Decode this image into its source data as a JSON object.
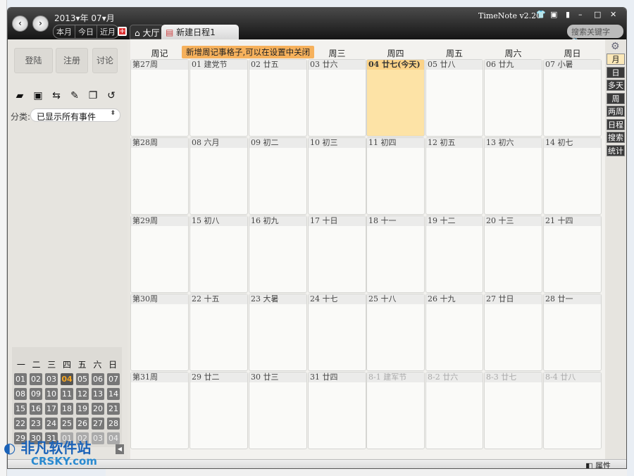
{
  "app": {
    "title": "TimeNote v2.20",
    "year": "2013",
    "year_suffix": "年",
    "month": "07",
    "month_suffix": "月",
    "quick": [
      "本月",
      "今日",
      "近月"
    ],
    "tabs": [
      "大厅",
      "新建日程1"
    ],
    "search_placeholder": "搜索关键字"
  },
  "left": {
    "buttons": [
      "登陆",
      "注册",
      "讨论"
    ],
    "category_label": "分类:",
    "category_value": "已显示所有事件",
    "tool_icons": [
      "folder-open-icon",
      "save-icon",
      "share-icon",
      "edit-icon",
      "copy-icon",
      "undo-icon"
    ]
  },
  "mini": {
    "weekdays": [
      "一",
      "二",
      "三",
      "四",
      "五",
      "六",
      "日"
    ],
    "days": [
      {
        "t": "01"
      },
      {
        "t": "02"
      },
      {
        "t": "03"
      },
      {
        "t": "04",
        "today": true
      },
      {
        "t": "05"
      },
      {
        "t": "06"
      },
      {
        "t": "07"
      },
      {
        "t": "08"
      },
      {
        "t": "09"
      },
      {
        "t": "10"
      },
      {
        "t": "11"
      },
      {
        "t": "12"
      },
      {
        "t": "13"
      },
      {
        "t": "14"
      },
      {
        "t": "15"
      },
      {
        "t": "16"
      },
      {
        "t": "17"
      },
      {
        "t": "18"
      },
      {
        "t": "19"
      },
      {
        "t": "20"
      },
      {
        "t": "21"
      },
      {
        "t": "22"
      },
      {
        "t": "23"
      },
      {
        "t": "24"
      },
      {
        "t": "25"
      },
      {
        "t": "26"
      },
      {
        "t": "27"
      },
      {
        "t": "28"
      },
      {
        "t": "29"
      },
      {
        "t": "30"
      },
      {
        "t": "31"
      },
      {
        "t": "01",
        "other": true
      },
      {
        "t": "02",
        "other": true
      },
      {
        "t": "03",
        "other": true
      },
      {
        "t": "04",
        "other": true
      }
    ]
  },
  "calendar": {
    "headers": [
      "周记",
      "周一",
      "周二",
      "周三",
      "周四",
      "周五",
      "周六",
      "周日"
    ],
    "tip": "新增周记事格子,可以在设置中关闭",
    "weeks": [
      {
        "label": "第27周",
        "days": [
          {
            "t": "01 建党节"
          },
          {
            "t": "02 廿五"
          },
          {
            "t": "03 廿六"
          },
          {
            "t": "04 廿七(今天)",
            "today": true
          },
          {
            "t": "05 廿八"
          },
          {
            "t": "06 廿九"
          },
          {
            "t": "07 小暑"
          }
        ]
      },
      {
        "label": "第28周",
        "days": [
          {
            "t": "08 六月"
          },
          {
            "t": "09 初二"
          },
          {
            "t": "10 初三"
          },
          {
            "t": "11 初四"
          },
          {
            "t": "12 初五"
          },
          {
            "t": "13 初六"
          },
          {
            "t": "14 初七"
          }
        ]
      },
      {
        "label": "第29周",
        "days": [
          {
            "t": "15 初八"
          },
          {
            "t": "16 初九"
          },
          {
            "t": "17 十日"
          },
          {
            "t": "18 十一"
          },
          {
            "t": "19 十二"
          },
          {
            "t": "20 十三"
          },
          {
            "t": "21 十四"
          }
        ]
      },
      {
        "label": "第30周",
        "days": [
          {
            "t": "22 十五"
          },
          {
            "t": "23 大暑"
          },
          {
            "t": "24 十七"
          },
          {
            "t": "25 十八"
          },
          {
            "t": "26 十九"
          },
          {
            "t": "27 廿日"
          },
          {
            "t": "28 廿一"
          }
        ]
      },
      {
        "label": "第31周",
        "days": [
          {
            "t": "29 廿二"
          },
          {
            "t": "30 廿三"
          },
          {
            "t": "31 廿四"
          },
          {
            "t": "8-1 建军节",
            "other": true
          },
          {
            "t": "8-2 廿六",
            "other": true
          },
          {
            "t": "8-3 廿七",
            "other": true
          },
          {
            "t": "8-4 廿八",
            "other": true
          }
        ]
      }
    ]
  },
  "views": [
    {
      "label": "月",
      "active": true
    },
    {
      "label": "日"
    },
    {
      "label": "多天"
    },
    {
      "label": "周"
    },
    {
      "label": "两周"
    },
    {
      "label": "日程"
    },
    {
      "label": "搜索"
    },
    {
      "label": "统计"
    }
  ],
  "status": {
    "properties": "属性"
  },
  "watermark": {
    "text": "非凡软件站",
    "sub": "CRSKY.com"
  }
}
